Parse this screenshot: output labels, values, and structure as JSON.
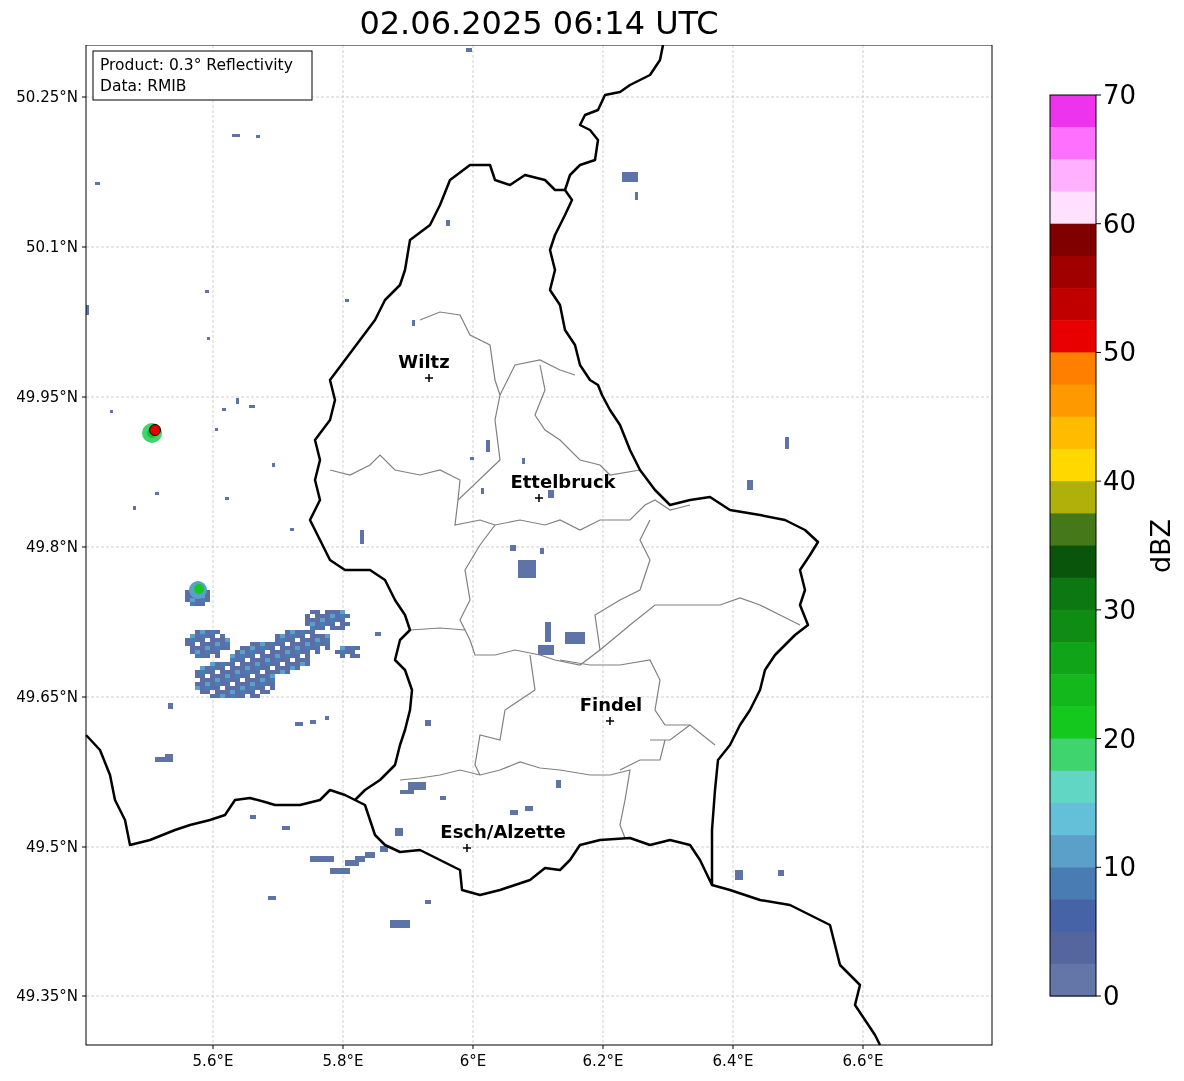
{
  "title": "02.06.2025 06:14 UTC",
  "info_box": {
    "lines": [
      "Product: 0.3° Reflectivity",
      "Data: RMIB"
    ]
  },
  "map": {
    "y_ticks": [
      "50.25°N",
      "50.1°N",
      "49.95°N",
      "49.8°N",
      "49.65°N",
      "49.5°N",
      "49.35°N"
    ],
    "x_ticks": [
      "5.6°E",
      "5.8°E",
      "6°E",
      "6.2°E",
      "6.4°E",
      "6.6°E"
    ],
    "cities": [
      {
        "name": "Wiltz"
      },
      {
        "name": "Ettelbruck"
      },
      {
        "name": "Findel"
      },
      {
        "name": "Esch/Alzette"
      }
    ]
  },
  "colorbar": {
    "label": "dBZ",
    "ticks": [
      "70",
      "60",
      "50",
      "40",
      "30",
      "20",
      "10",
      "0"
    ],
    "bands": [
      {
        "color": "#ee33ee"
      },
      {
        "color": "#ff70ff"
      },
      {
        "color": "#ffb0ff"
      },
      {
        "color": "#ffe0ff"
      },
      {
        "color": "#800000"
      },
      {
        "color": "#a00000"
      },
      {
        "color": "#c00000"
      },
      {
        "color": "#e80000"
      },
      {
        "color": "#ff7f00"
      },
      {
        "color": "#ff9900"
      },
      {
        "color": "#ffbb00"
      },
      {
        "color": "#ffd800"
      },
      {
        "color": "#b0b00a"
      },
      {
        "color": "#447818"
      },
      {
        "color": "#0a550c"
      },
      {
        "color": "#0c7812"
      },
      {
        "color": "#0e8c14"
      },
      {
        "color": "#10a418"
      },
      {
        "color": "#12b81c"
      },
      {
        "color": "#14c81e"
      },
      {
        "color": "#3fd46e"
      },
      {
        "color": "#62d6c4"
      },
      {
        "color": "#64c0d8"
      },
      {
        "color": "#5aa0c8"
      },
      {
        "color": "#4a7cb4"
      },
      {
        "color": "#4563a6"
      },
      {
        "color": "#55669e"
      },
      {
        "color": "#6476a8"
      }
    ]
  }
}
